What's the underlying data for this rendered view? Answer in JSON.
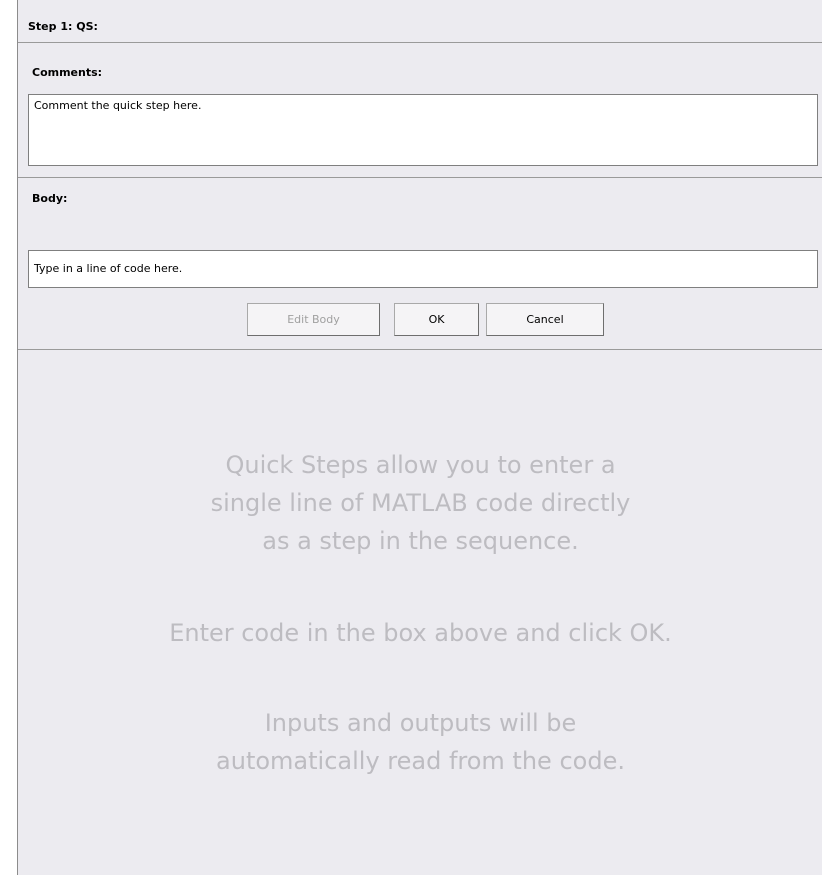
{
  "step": {
    "title": "Step 1: QS:"
  },
  "comments": {
    "label": "Comments:",
    "value": "Comment the quick step here."
  },
  "body": {
    "label": "Body:",
    "value": "Type in a line of code here."
  },
  "buttons": {
    "edit_body": "Edit Body",
    "ok": "OK",
    "cancel": "Cancel"
  },
  "info": {
    "line1": "Quick Steps allow you to enter a",
    "line2": "single line of MATLAB code directly",
    "line3": "as a step in the sequence.",
    "line4": "Enter code in the box above and click OK.",
    "line5": "Inputs and outputs will be",
    "line6": "automatically read from the code."
  }
}
